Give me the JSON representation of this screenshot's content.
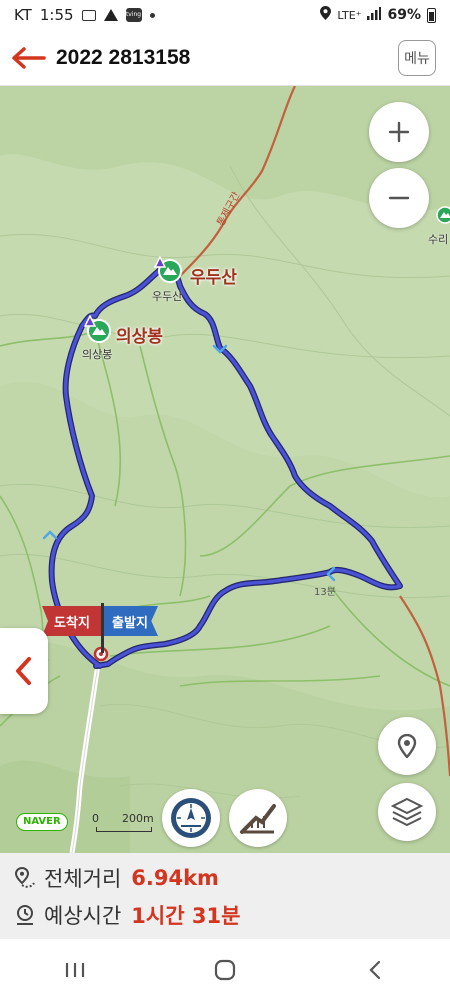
{
  "status_bar": {
    "carrier": "KT",
    "time": "1:55",
    "app_badge": "tving",
    "network": "LTE⁺",
    "battery": "69%"
  },
  "header": {
    "title": "2022 2813158",
    "menu_label": "메뉴"
  },
  "map": {
    "peaks": [
      {
        "label": "우두산",
        "sublabel": "우두산"
      },
      {
        "label": "의상봉",
        "sublabel": "의상봉"
      }
    ],
    "offscreen_peak": "수리",
    "road_label": "통제구간",
    "trail_time_label": "13분",
    "flags": {
      "end": "도착지",
      "start": "출발지"
    },
    "naver_logo": "NAVER",
    "scale": {
      "zero": "0",
      "distance": "200m"
    },
    "route_color": "#3a3fc9",
    "road_color": "#b4432c"
  },
  "info": {
    "distance_label": "전체거리",
    "distance_value": "6.94km",
    "time_label": "예상시간",
    "time_value": "1시간 31분"
  }
}
